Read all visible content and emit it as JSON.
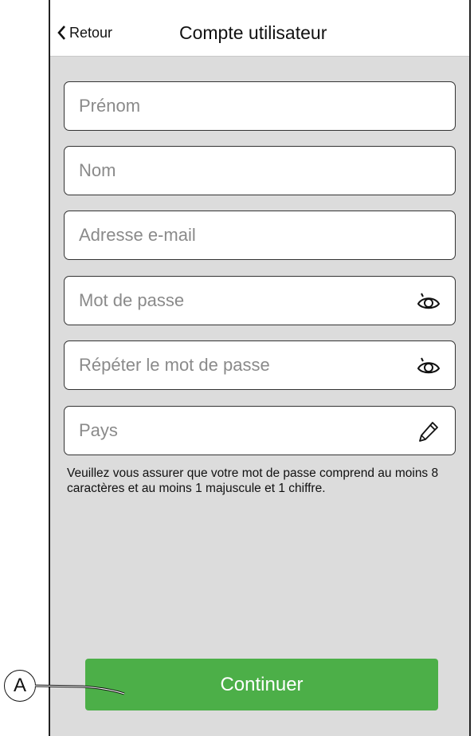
{
  "header": {
    "back_label": "Retour",
    "back_icon": "chevron-left-icon",
    "title": "Compte utilisateur"
  },
  "form": {
    "first_name": {
      "placeholder": "Prénom",
      "value": ""
    },
    "last_name": {
      "placeholder": "Nom",
      "value": ""
    },
    "email": {
      "placeholder": "Adresse e-mail",
      "value": ""
    },
    "password": {
      "placeholder": "Mot de passe",
      "value": "",
      "icon": "eye-icon"
    },
    "password_repeat": {
      "placeholder": "Répéter le mot de passe",
      "value": "",
      "icon": "eye-icon"
    },
    "country": {
      "placeholder": "Pays",
      "value": "",
      "icon": "pencil-icon"
    }
  },
  "hint": "Veuillez vous assurer que votre mot de passe comprend au moins 8 caractères et au moins 1 majuscule et 1 chiffre.",
  "continue_label": "Continuer",
  "callout_label": "A",
  "colors": {
    "background": "#dcdcdc",
    "header": "#ffffff",
    "accent": "#4caf48",
    "border": "#333333"
  }
}
